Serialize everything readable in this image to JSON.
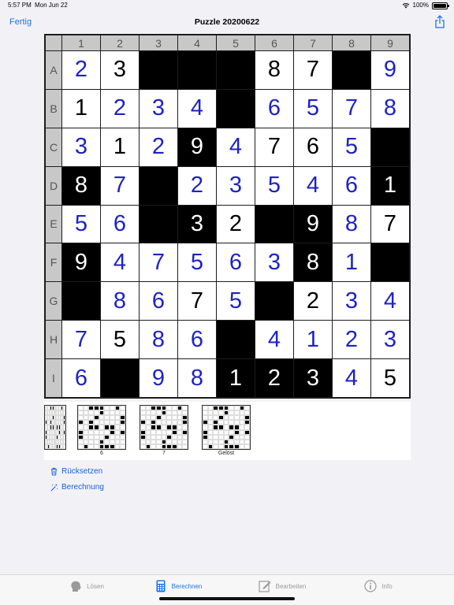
{
  "status": {
    "time": "5:57 PM",
    "date": "Mon Jun 22",
    "battery": "100%"
  },
  "nav": {
    "done_label": "Fertig",
    "title": "Puzzle 20200622"
  },
  "board": {
    "columns": [
      "1",
      "2",
      "3",
      "4",
      "5",
      "6",
      "7",
      "8",
      "9"
    ],
    "rows": [
      "A",
      "B",
      "C",
      "D",
      "E",
      "F",
      "G",
      "H",
      "I"
    ],
    "cells": [
      [
        {
          "v": "2",
          "s": "blue"
        },
        {
          "v": "3",
          "s": "given"
        },
        {
          "v": "",
          "s": "black"
        },
        {
          "v": "",
          "s": "black"
        },
        {
          "v": "",
          "s": "black"
        },
        {
          "v": "8",
          "s": "given"
        },
        {
          "v": "7",
          "s": "given"
        },
        {
          "v": "",
          "s": "black"
        },
        {
          "v": "9",
          "s": "blue"
        }
      ],
      [
        {
          "v": "1",
          "s": "given"
        },
        {
          "v": "2",
          "s": "blue"
        },
        {
          "v": "3",
          "s": "blue"
        },
        {
          "v": "4",
          "s": "blue"
        },
        {
          "v": "",
          "s": "black"
        },
        {
          "v": "6",
          "s": "blue"
        },
        {
          "v": "5",
          "s": "blue"
        },
        {
          "v": "7",
          "s": "blue"
        },
        {
          "v": "8",
          "s": "blue"
        }
      ],
      [
        {
          "v": "3",
          "s": "blue"
        },
        {
          "v": "1",
          "s": "given"
        },
        {
          "v": "2",
          "s": "blue"
        },
        {
          "v": "9",
          "s": "black"
        },
        {
          "v": "4",
          "s": "blue"
        },
        {
          "v": "7",
          "s": "given"
        },
        {
          "v": "6",
          "s": "given"
        },
        {
          "v": "5",
          "s": "blue"
        },
        {
          "v": "",
          "s": "black"
        }
      ],
      [
        {
          "v": "8",
          "s": "black"
        },
        {
          "v": "7",
          "s": "blue"
        },
        {
          "v": "",
          "s": "black"
        },
        {
          "v": "2",
          "s": "blue"
        },
        {
          "v": "3",
          "s": "blue"
        },
        {
          "v": "5",
          "s": "blue"
        },
        {
          "v": "4",
          "s": "blue"
        },
        {
          "v": "6",
          "s": "blue"
        },
        {
          "v": "1",
          "s": "black"
        }
      ],
      [
        {
          "v": "5",
          "s": "blue"
        },
        {
          "v": "6",
          "s": "blue"
        },
        {
          "v": "",
          "s": "black"
        },
        {
          "v": "3",
          "s": "black"
        },
        {
          "v": "2",
          "s": "given"
        },
        {
          "v": "",
          "s": "black"
        },
        {
          "v": "9",
          "s": "black"
        },
        {
          "v": "8",
          "s": "blue"
        },
        {
          "v": "7",
          "s": "given"
        }
      ],
      [
        {
          "v": "9",
          "s": "black"
        },
        {
          "v": "4",
          "s": "blue"
        },
        {
          "v": "7",
          "s": "blue"
        },
        {
          "v": "5",
          "s": "blue"
        },
        {
          "v": "6",
          "s": "blue"
        },
        {
          "v": "3",
          "s": "blue"
        },
        {
          "v": "8",
          "s": "black"
        },
        {
          "v": "1",
          "s": "blue"
        },
        {
          "v": "",
          "s": "black"
        }
      ],
      [
        {
          "v": "",
          "s": "black"
        },
        {
          "v": "8",
          "s": "blue"
        },
        {
          "v": "6",
          "s": "blue"
        },
        {
          "v": "7",
          "s": "given"
        },
        {
          "v": "5",
          "s": "blue"
        },
        {
          "v": "",
          "s": "black"
        },
        {
          "v": "2",
          "s": "given"
        },
        {
          "v": "3",
          "s": "blue"
        },
        {
          "v": "4",
          "s": "blue"
        }
      ],
      [
        {
          "v": "7",
          "s": "blue"
        },
        {
          "v": "5",
          "s": "given"
        },
        {
          "v": "8",
          "s": "blue"
        },
        {
          "v": "6",
          "s": "blue"
        },
        {
          "v": "",
          "s": "black"
        },
        {
          "v": "4",
          "s": "blue"
        },
        {
          "v": "1",
          "s": "blue"
        },
        {
          "v": "2",
          "s": "blue"
        },
        {
          "v": "3",
          "s": "blue"
        }
      ],
      [
        {
          "v": "6",
          "s": "blue"
        },
        {
          "v": "",
          "s": "black"
        },
        {
          "v": "9",
          "s": "blue"
        },
        {
          "v": "8",
          "s": "blue"
        },
        {
          "v": "1",
          "s": "black"
        },
        {
          "v": "2",
          "s": "black"
        },
        {
          "v": "3",
          "s": "black"
        },
        {
          "v": "4",
          "s": "blue"
        },
        {
          "v": "5",
          "s": "given"
        }
      ]
    ]
  },
  "history": [
    {
      "caption": ""
    },
    {
      "caption": "6"
    },
    {
      "caption": "7"
    },
    {
      "caption": "Gelöst"
    }
  ],
  "actions": {
    "reset_label": "Rücksetzen",
    "compute_label": "Berechnung"
  },
  "tabs": [
    {
      "label": "Lösen",
      "icon": "head-icon"
    },
    {
      "label": "Berechnen",
      "icon": "calculator-icon"
    },
    {
      "label": "Bearbeiten",
      "icon": "edit-icon"
    },
    {
      "label": "Info",
      "icon": "info-icon"
    }
  ],
  "colors": {
    "accent": "#1a73e8",
    "entered_digit": "#1e22c4"
  }
}
